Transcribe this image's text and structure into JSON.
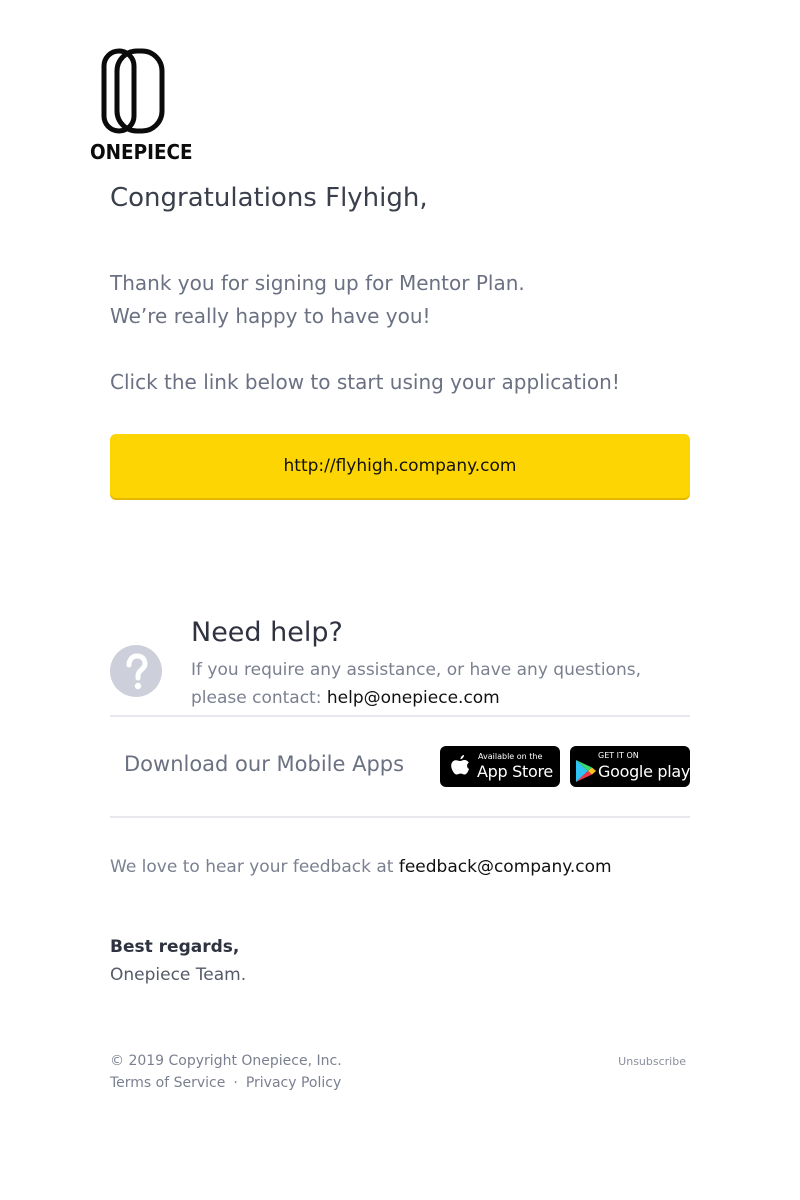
{
  "brand": {
    "name": "ONEPIECE",
    "accent_color": "#fdd503"
  },
  "greeting": "Congratulations Flyhigh,",
  "body": {
    "line1": "Thank you for signing up for Mentor Plan.",
    "line2": "We’re really happy to have you!",
    "line3": "Click the link below to start using your application!"
  },
  "cta": {
    "label": "http://flyhigh.company.com"
  },
  "help": {
    "icon": "question-circle-icon",
    "title": "Need help?",
    "text": "If you require any assistance, or have any questions, please contact:",
    "email": "help@onepiece.com"
  },
  "apps": {
    "label": "Download our Mobile Apps",
    "appstore": {
      "icon": "apple-icon",
      "small": "Available on the",
      "big": "App Store"
    },
    "googleplay": {
      "icon": "google-play-icon",
      "small": "GET IT ON",
      "big": "Google play"
    }
  },
  "feedback": {
    "text": "We love to hear your feedback at",
    "email": "feedback@company.com"
  },
  "signoff": {
    "regards": "Best regards,",
    "team": "Onepiece Team."
  },
  "footer": {
    "copyright": "© 2019 Copyright Onepiece, Inc.",
    "terms": "Terms of Service",
    "separator": "·",
    "privacy": "Privacy Policy",
    "unsubscribe": "Unsubscribe"
  }
}
